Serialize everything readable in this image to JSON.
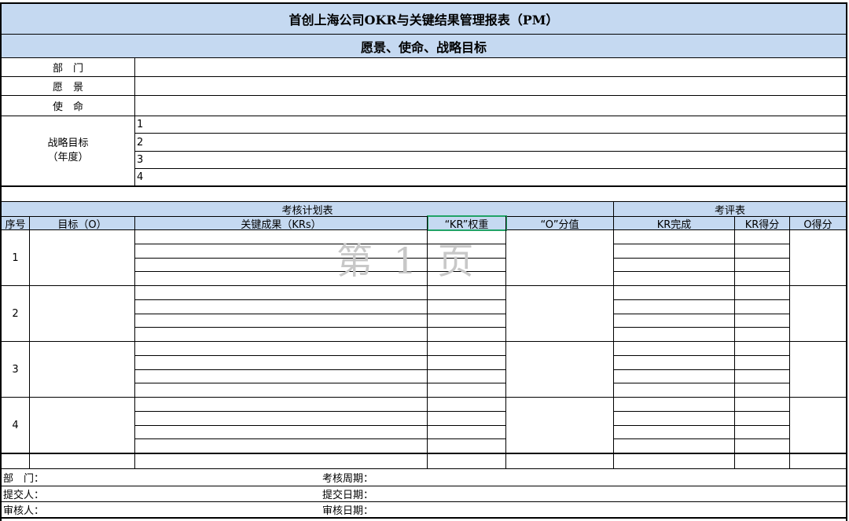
{
  "report": {
    "title": "首创上海公司OKR与关键结果管理报表（PM）",
    "section_title": "愿景、使命、战略目标"
  },
  "info_rows": {
    "department": "部　门",
    "vision": "愿　景",
    "mission": "使　命",
    "strategy_line1": "战略目标",
    "strategy_line2": "（年度）",
    "strategy_items": [
      "1",
      "2",
      "3",
      "4"
    ]
  },
  "plan_table": {
    "group_plan": "考核计划表",
    "group_eval": "考评表",
    "columns": {
      "index": "序号",
      "objective": "目标（O）",
      "key_results": "关键成果（KRs）",
      "kr_weight": "“KR”权重",
      "o_value": "“O”分值",
      "kr_done": "KR完成",
      "kr_score": "KR得分",
      "o_score": "O得分"
    },
    "row_numbers": [
      "1",
      "2",
      "3",
      "4"
    ]
  },
  "watermark": "第 1 页",
  "footer": {
    "department": "部　门：",
    "submitter": "提交人：",
    "reviewer": "审核人：",
    "period": "考核周期：",
    "submit_date": "提交日期：",
    "review_date": "审核日期："
  },
  "colors": {
    "header_fill": "#c5d9f1",
    "selection": "#21a366"
  }
}
